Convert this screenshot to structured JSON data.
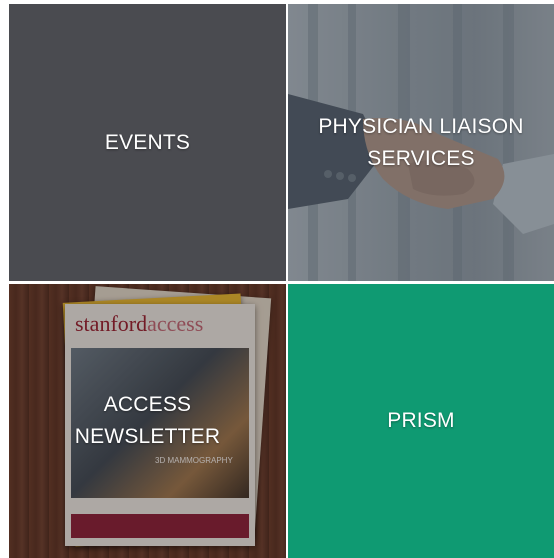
{
  "tiles": [
    {
      "id": "events",
      "label_lines": [
        "EVENTS"
      ],
      "color": "#4a4b50"
    },
    {
      "id": "physician-liaison-services",
      "label_lines": [
        "PHYSICIAN LIAISON",
        "SERVICES"
      ],
      "image": "handshake"
    },
    {
      "id": "access-newsletter",
      "label_lines": [
        "ACCESS",
        "NEWSLETTER"
      ],
      "image": "magazine-stack",
      "magazine": {
        "title_a": "stanford",
        "title_b": "access",
        "feature": "3D MAMMOGRAPHY"
      }
    },
    {
      "id": "prism",
      "label_lines": [
        "PRISM"
      ],
      "color": "#0f9a72"
    }
  ]
}
